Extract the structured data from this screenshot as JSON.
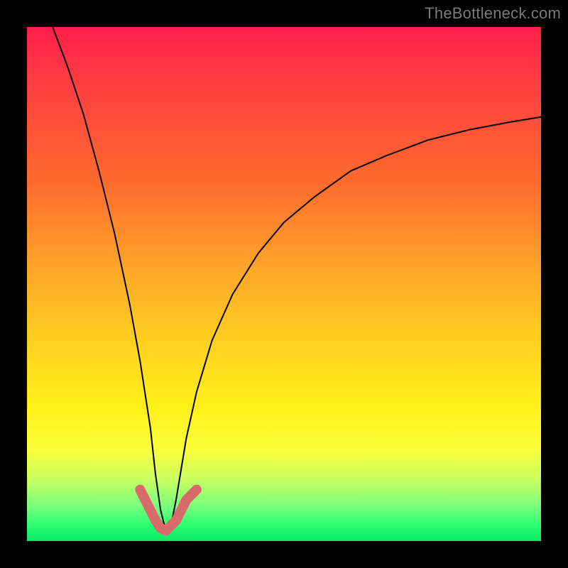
{
  "watermark": "TheBottleneck.com",
  "chart_data": {
    "type": "line",
    "title": "",
    "xlabel": "",
    "ylabel": "",
    "xlim": [
      0,
      100
    ],
    "ylim": [
      0,
      100
    ],
    "grid": false,
    "legend": false,
    "background": "rainbow-gradient-red-to-green",
    "minimum_x": 27,
    "series": [
      {
        "name": "bottleneck-curve",
        "color": "#000000",
        "stroke_width": 2,
        "x": [
          5,
          8,
          11,
          14,
          17,
          20,
          22,
          24,
          25,
          26,
          27,
          28,
          29,
          30,
          31,
          33,
          36,
          40,
          45,
          50,
          56,
          63,
          70,
          78,
          86,
          94,
          100
        ],
        "values": [
          100,
          92,
          83,
          72,
          60,
          46,
          35,
          22,
          13,
          6,
          2,
          3,
          8,
          14,
          20,
          29,
          39,
          48,
          56,
          62,
          67,
          72,
          75,
          78,
          80,
          81.5,
          82.5
        ]
      },
      {
        "name": "valley-highlight",
        "color": "#d96a6c",
        "stroke_width": 10,
        "x": [
          22,
          23,
          24,
          25,
          26,
          27,
          28,
          29,
          30,
          31,
          33
        ],
        "values": [
          10,
          8,
          6,
          4,
          2.5,
          2,
          3,
          4,
          6,
          8,
          10
        ]
      }
    ]
  }
}
